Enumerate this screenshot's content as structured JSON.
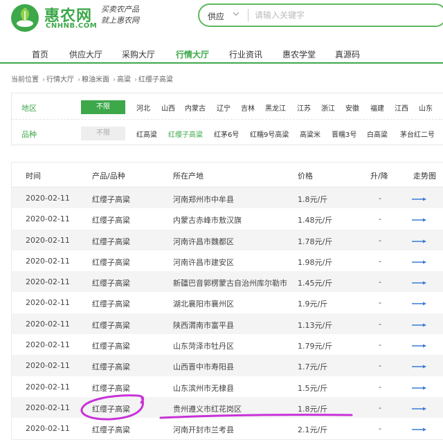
{
  "header": {
    "site_name": "惠农网",
    "domain": "CNHNB.COM",
    "slogan_line1": "买卖农产品",
    "slogan_line2": "就上惠农网",
    "search": {
      "category": "供应",
      "placeholder": "请输入关键字"
    }
  },
  "nav": {
    "items": [
      "首页",
      "供应大厅",
      "采购大厅",
      "行情大厅",
      "行业资讯",
      "惠农学堂",
      "真源码"
    ],
    "active_index": 3
  },
  "breadcrumb": [
    "当前位置",
    "行情大厅",
    "粮油米面",
    "高粱",
    "红缨子高粱"
  ],
  "filters": {
    "region": {
      "label": "地区",
      "all_label": "不限",
      "options": [
        "河北",
        "山西",
        "内蒙古",
        "辽宁",
        "吉林",
        "黑龙江",
        "江苏",
        "浙江",
        "安徽",
        "福建",
        "江西",
        "山东"
      ]
    },
    "variety": {
      "label": "品种",
      "all_label": "不限",
      "options": [
        "红高粱",
        "红缨子高粱",
        "红茅6号",
        "红糯9号高粱",
        "高粱米",
        "晋糯3号",
        "白高粱",
        "茅台红二号"
      ],
      "selected": "红缨子高粱"
    }
  },
  "table": {
    "headers": [
      "时间",
      "产品/品种",
      "所在产地",
      "价格",
      "升/降",
      "走势图"
    ],
    "rows": [
      {
        "date": "2020-02-11",
        "product": "红缨子高粱",
        "origin": "河南郑州市中牟县",
        "price": "1.8元/斤",
        "change": "-"
      },
      {
        "date": "2020-02-11",
        "product": "红缨子高粱",
        "origin": "内蒙古赤峰市敖汉旗",
        "price": "1.48元/斤",
        "change": "-"
      },
      {
        "date": "2020-02-11",
        "product": "红缨子高粱",
        "origin": "河南许昌市魏都区",
        "price": "1.78元/斤",
        "change": "-"
      },
      {
        "date": "2020-02-11",
        "product": "红缨子高粱",
        "origin": "河南许昌市建安区",
        "price": "1.98元/斤",
        "change": "-"
      },
      {
        "date": "2020-02-11",
        "product": "红缨子高粱",
        "origin": "新疆巴音郭楞蒙古自治州库尔勒市",
        "price": "1.45元/斤",
        "change": "-"
      },
      {
        "date": "2020-02-11",
        "product": "红缨子高粱",
        "origin": "湖北襄阳市襄州区",
        "price": "1.9元/斤",
        "change": "-"
      },
      {
        "date": "2020-02-11",
        "product": "红缨子高粱",
        "origin": "陕西渭南市富平县",
        "price": "1.13元/斤",
        "change": "-"
      },
      {
        "date": "2020-02-11",
        "product": "红缨子高粱",
        "origin": "山东菏泽市牡丹区",
        "price": "1.79元/斤",
        "change": "-"
      },
      {
        "date": "2020-02-11",
        "product": "红缨子高粱",
        "origin": "山西晋中市寿阳县",
        "price": "1.7元/斤",
        "change": "-"
      },
      {
        "date": "2020-02-11",
        "product": "红缨子高粱",
        "origin": "山东滨州市无棣县",
        "price": "1.5元/斤",
        "change": "-"
      },
      {
        "date": "2020-02-11",
        "product": "红缨子高粱",
        "origin": "贵州遵义市红花岗区",
        "price": "1.8元/斤",
        "change": "-"
      },
      {
        "date": "2020-02-11",
        "product": "红缨子高粱",
        "origin": "河南开封市兰考县",
        "price": "2.1元/斤",
        "change": "-"
      }
    ]
  },
  "colors": {
    "brand_green": "#3da84a",
    "trend_arrow": "#3a7bd5",
    "annotation": "#c832d8"
  }
}
